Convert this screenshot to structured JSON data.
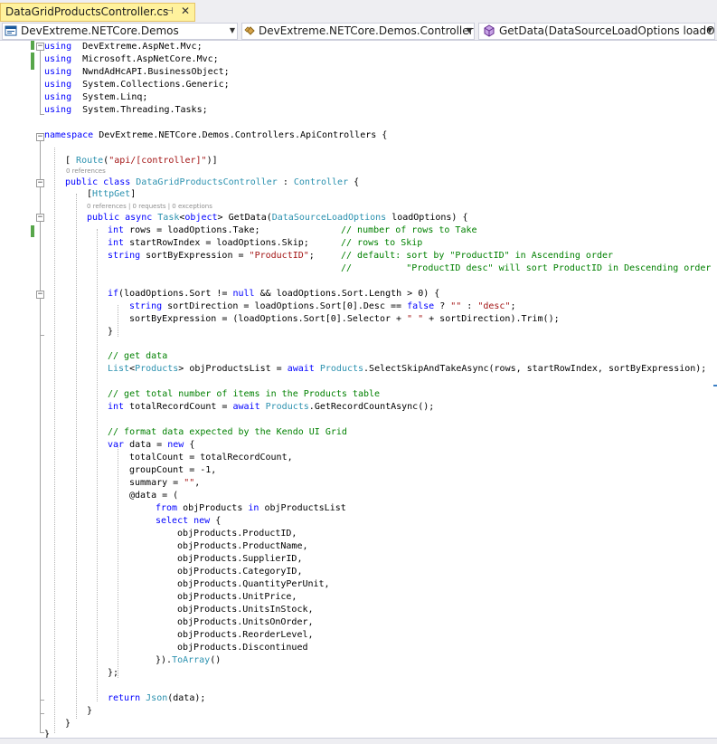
{
  "tab": {
    "title": "DataGridProductsController.cs",
    "pin": "⊣",
    "close": "✕"
  },
  "nav": {
    "project": "DevExtreme.NETCore.Demos",
    "type": "DevExtreme.NETCore.Demos.Controllers",
    "member": "GetData(DataSourceLoadOptions loadOptions)"
  },
  "codelens": {
    "class_refs": "0 references",
    "method_info": "0 references | 0 requests | 0 exceptions"
  },
  "code_lines": [
    [
      [
        "kw",
        "using"
      ],
      [
        "",
        "  DevExtreme.AspNet.Mvc;"
      ]
    ],
    [
      [
        "kw",
        "using"
      ],
      [
        "",
        "  Microsoft.AspNetCore.Mvc;"
      ]
    ],
    [
      [
        "kw",
        "using"
      ],
      [
        "",
        "  NwndAdHcAPI.BusinessObject;"
      ]
    ],
    [
      [
        "kw",
        "using"
      ],
      [
        "",
        "  System.Collections.Generic;"
      ]
    ],
    [
      [
        "kw",
        "using"
      ],
      [
        "",
        "  System.Linq;"
      ]
    ],
    [
      [
        "kw",
        "using"
      ],
      [
        "",
        "  System.Threading.Tasks;"
      ]
    ],
    [],
    [
      [
        "kw",
        "namespace"
      ],
      [
        "",
        " DevExtreme.NETCore.Demos.Controllers.ApiControllers {"
      ]
    ],
    [],
    [
      [
        "",
        "[ "
      ],
      [
        "ty",
        "Route"
      ],
      [
        "",
        "("
      ],
      [
        "st",
        "\"api/[controller]\""
      ],
      [
        "",
        ")]"
      ]
    ],
    [
      [
        "kw",
        "public class"
      ],
      [
        "",
        " "
      ],
      [
        "ty",
        "DataGridProductsController"
      ],
      [
        "",
        " : "
      ],
      [
        "ty",
        "Controller"
      ],
      [
        "",
        " {"
      ]
    ],
    [
      [
        "",
        "["
      ],
      [
        "ty",
        "HttpGet"
      ],
      [
        "",
        "]"
      ]
    ],
    [
      [
        "kw",
        "public async"
      ],
      [
        "",
        " "
      ],
      [
        "ty",
        "Task"
      ],
      [
        "",
        "<"
      ],
      [
        "kw",
        "object"
      ],
      [
        "",
        "> GetData("
      ],
      [
        "ty",
        "DataSourceLoadOptions"
      ],
      [
        "",
        " loadOptions) {"
      ]
    ],
    [
      [
        "kw",
        "int"
      ],
      [
        "",
        " rows = loadOptions.Take;"
      ]
    ],
    [
      [
        "kw",
        "int"
      ],
      [
        "",
        " startRowIndex = loadOptions.Skip;"
      ]
    ],
    [
      [
        "kw",
        "string"
      ],
      [
        "",
        " sortByExpression = "
      ],
      [
        "st",
        "\"ProductID\""
      ],
      [
        "",
        ";"
      ]
    ],
    [],
    [],
    [
      [
        "kw",
        "if"
      ],
      [
        "",
        "(loadOptions.Sort != "
      ],
      [
        "kw",
        "null"
      ],
      [
        "",
        " && loadOptions.Sort.Length > 0) {"
      ]
    ],
    [
      [
        "kw",
        "string"
      ],
      [
        "",
        " sortDirection = loadOptions.Sort[0].Desc == "
      ],
      [
        "kw",
        "false"
      ],
      [
        "",
        " ? "
      ],
      [
        "st",
        "\"\""
      ],
      [
        "",
        " : "
      ],
      [
        "st",
        "\"desc\""
      ],
      [
        "",
        ";"
      ]
    ],
    [
      [
        "",
        "sortByExpression = (loadOptions.Sort[0].Selector + "
      ],
      [
        "st",
        "\" \""
      ],
      [
        "",
        " + sortDirection).Trim();"
      ]
    ],
    [
      [
        "",
        "}"
      ]
    ],
    [],
    [
      [
        "cm",
        "// get data"
      ]
    ],
    [
      [
        "ty",
        "List"
      ],
      [
        "",
        "<"
      ],
      [
        "ty",
        "Products"
      ],
      [
        "",
        "> objProductsList = "
      ],
      [
        "kw",
        "await"
      ],
      [
        "",
        " "
      ],
      [
        "mt",
        "Products"
      ],
      [
        "",
        ".SelectSkipAndTakeAsync(rows, startRowIndex, sortByExpression);"
      ]
    ],
    [],
    [
      [
        "cm",
        "// get total number of items in the Products table"
      ]
    ],
    [
      [
        "kw",
        "int"
      ],
      [
        "",
        " totalRecordCount = "
      ],
      [
        "kw",
        "await"
      ],
      [
        "",
        " "
      ],
      [
        "mt",
        "Products"
      ],
      [
        "",
        ".GetRecordCountAsync();"
      ]
    ],
    [],
    [
      [
        "cm",
        "// format data expected by the Kendo UI Grid"
      ]
    ],
    [
      [
        "kw",
        "var"
      ],
      [
        "",
        " data = "
      ],
      [
        "kw",
        "new"
      ],
      [
        "",
        " {"
      ]
    ],
    [
      [
        "",
        "totalCount = totalRecordCount,"
      ]
    ],
    [
      [
        "",
        "groupCount = -1,"
      ]
    ],
    [
      [
        "",
        "summary = "
      ],
      [
        "st",
        "\"\""
      ],
      [
        "",
        ","
      ]
    ],
    [
      [
        "",
        "@data = ("
      ]
    ],
    [
      [
        "kw",
        "from"
      ],
      [
        "",
        " objProducts "
      ],
      [
        "kw",
        "in"
      ],
      [
        "",
        " objProductsList"
      ]
    ],
    [
      [
        "kw",
        "select new"
      ],
      [
        "",
        " {"
      ]
    ],
    [
      [
        "",
        "objProducts.ProductID,"
      ]
    ],
    [
      [
        "",
        "objProducts.ProductName,"
      ]
    ],
    [
      [
        "",
        "objProducts.SupplierID,"
      ]
    ],
    [
      [
        "",
        "objProducts.CategoryID,"
      ]
    ],
    [
      [
        "",
        "objProducts.QuantityPerUnit,"
      ]
    ],
    [
      [
        "",
        "objProducts.UnitPrice,"
      ]
    ],
    [
      [
        "",
        "objProducts.UnitsInStock,"
      ]
    ],
    [
      [
        "",
        "objProducts.UnitsOnOrder,"
      ]
    ],
    [
      [
        "",
        "objProducts.ReorderLevel,"
      ]
    ],
    [
      [
        "",
        "objProducts.Discontinued"
      ]
    ],
    [
      [
        "",
        "})."
      ],
      [
        "mt",
        "ToArray"
      ],
      [
        "",
        "()"
      ]
    ],
    [
      [
        "",
        "};"
      ]
    ],
    [],
    [
      [
        "kw",
        "return"
      ],
      [
        "",
        " "
      ],
      [
        "mt",
        "Json"
      ],
      [
        "",
        "(data);"
      ]
    ],
    [
      [
        "",
        "}"
      ]
    ],
    [
      [
        "",
        "}"
      ]
    ],
    [
      [
        "",
        "}"
      ]
    ]
  ],
  "comments": [
    "// number of rows to Take",
    "// rows to Skip",
    "// default: sort by \"ProductID\" in Ascending order",
    "//          \"ProductID desc\" will sort ProductID in Descending order"
  ]
}
